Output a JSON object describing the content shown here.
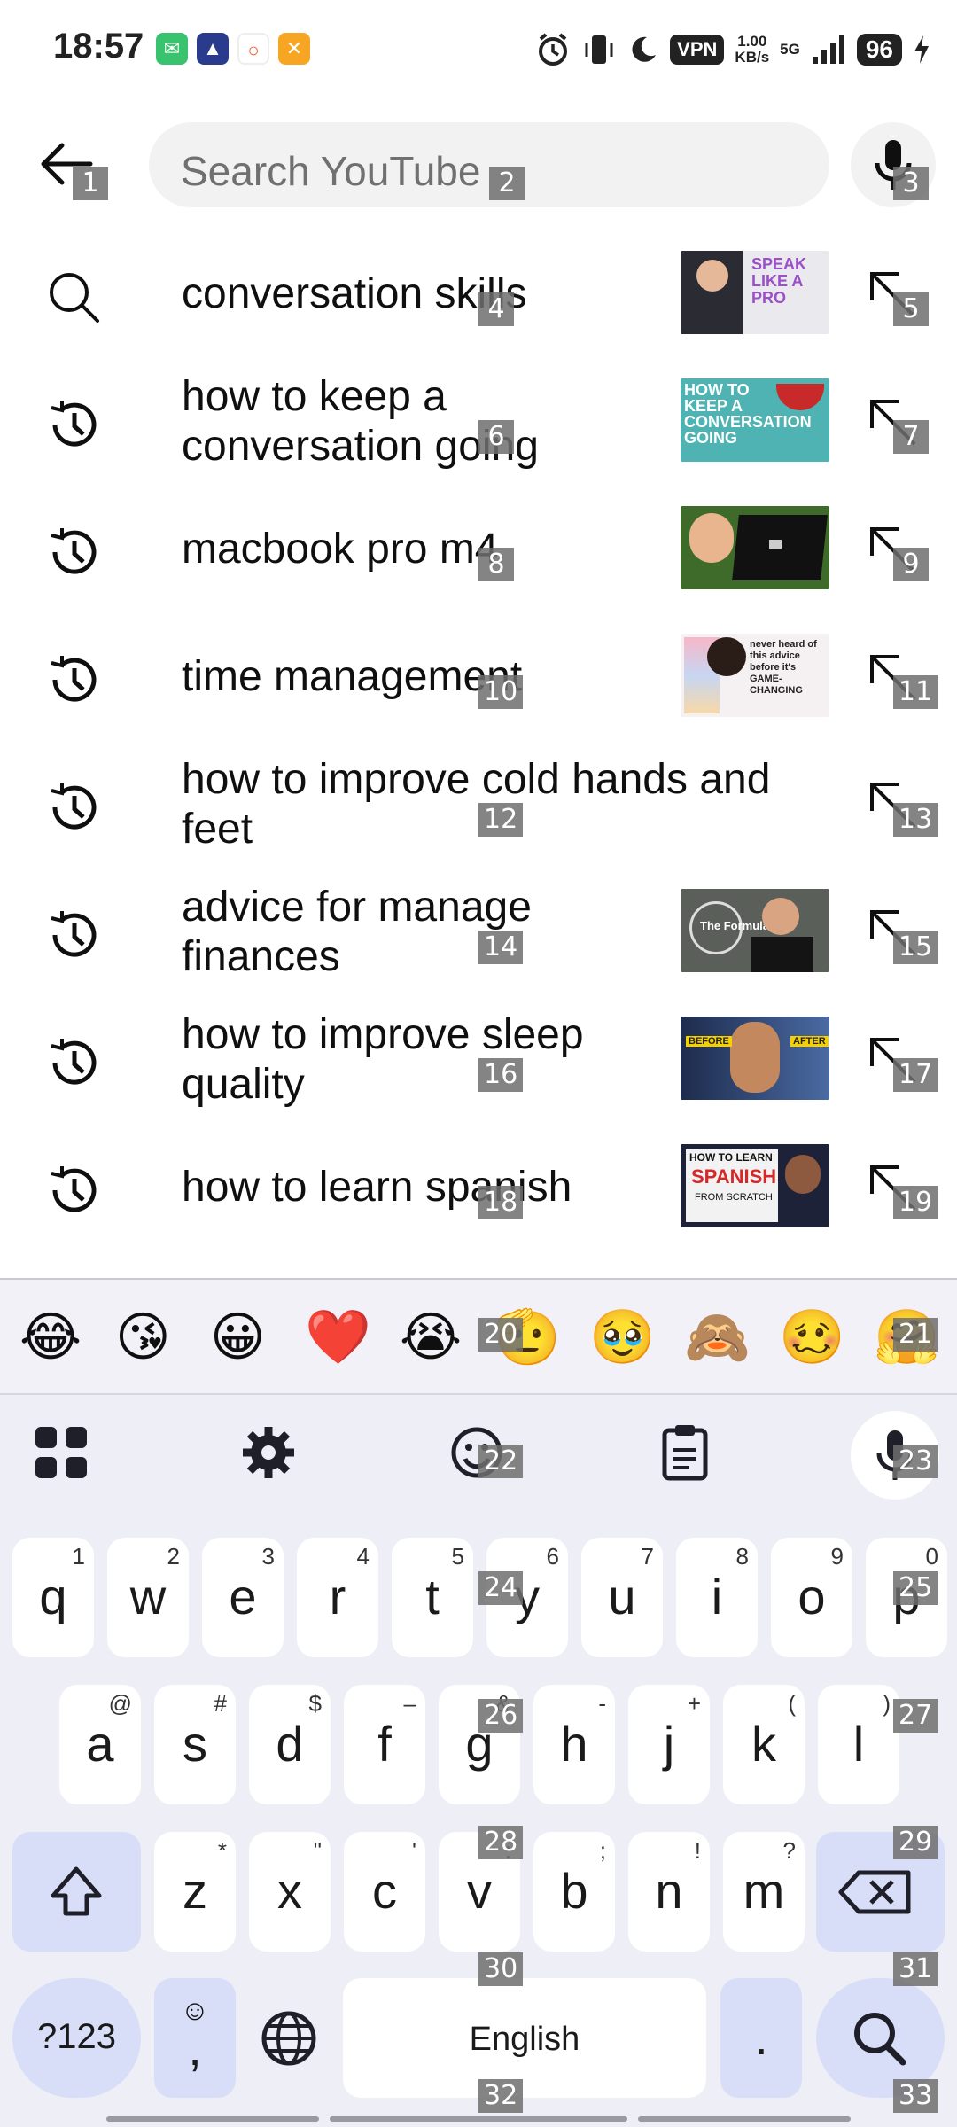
{
  "status_bar": {
    "time": "18:57",
    "vpn": "VPN",
    "speed_value": "1.00",
    "speed_unit": "KB/s",
    "network": "5G",
    "battery": "96"
  },
  "header": {
    "search_placeholder": "Search YouTube"
  },
  "suggestions": [
    {
      "text": "conversation skills",
      "icon": "search-icon"
    },
    {
      "text": "how to keep a conversation going",
      "icon": "history-icon"
    },
    {
      "text": "macbook pro m4",
      "icon": "history-icon"
    },
    {
      "text": "time management",
      "icon": "history-icon"
    },
    {
      "text": "how to improve cold hands and feet",
      "icon": "history-icon"
    },
    {
      "text": "advice for manage finances",
      "icon": "history-icon"
    },
    {
      "text": "how to improve sleep quality",
      "icon": "history-icon"
    },
    {
      "text": "how to learn spanish",
      "icon": "history-icon"
    }
  ],
  "thumbnails": {
    "t1_text": "SPEAK LIKE A PRO",
    "t2_text": "HOW TO KEEP A CONVERSATION GOING",
    "t4_text": "never heard of this advice before it's GAME-CHANGING",
    "t5_text": "The Formula",
    "t6_before": "BEFORE",
    "t6_after": "AFTER",
    "t7_line1": "HOW TO LEARN",
    "t7_line2": "SPANISH",
    "t7_line3": "FROM SCRATCH"
  },
  "keyboard": {
    "emojis": [
      "😂",
      "😘",
      "😀",
      "❤️",
      "😭",
      "🫡",
      "🥹",
      "🙈",
      "🥴",
      "🤗"
    ],
    "row1": [
      {
        "ch": "q",
        "sub": "1"
      },
      {
        "ch": "w",
        "sub": "2"
      },
      {
        "ch": "e",
        "sub": "3"
      },
      {
        "ch": "r",
        "sub": "4"
      },
      {
        "ch": "t",
        "sub": "5"
      },
      {
        "ch": "y",
        "sub": "6"
      },
      {
        "ch": "u",
        "sub": "7"
      },
      {
        "ch": "i",
        "sub": "8"
      },
      {
        "ch": "o",
        "sub": "9"
      },
      {
        "ch": "p",
        "sub": "0"
      }
    ],
    "row2": [
      {
        "ch": "a",
        "sub": "@"
      },
      {
        "ch": "s",
        "sub": "#"
      },
      {
        "ch": "d",
        "sub": "$"
      },
      {
        "ch": "f",
        "sub": "–"
      },
      {
        "ch": "g",
        "sub": "&"
      },
      {
        "ch": "h",
        "sub": "-"
      },
      {
        "ch": "j",
        "sub": "+"
      },
      {
        "ch": "k",
        "sub": "("
      },
      {
        "ch": "l",
        "sub": ")"
      }
    ],
    "row3": [
      {
        "ch": "z",
        "sub": "*"
      },
      {
        "ch": "x",
        "sub": "\""
      },
      {
        "ch": "c",
        "sub": "'"
      },
      {
        "ch": "v",
        "sub": ":"
      },
      {
        "ch": "b",
        "sub": ";"
      },
      {
        "ch": "n",
        "sub": "!"
      },
      {
        "ch": "m",
        "sub": "?"
      }
    ],
    "symbols_label": "?123",
    "comma_label": ",",
    "space_label": "English",
    "period_label": "."
  },
  "tags": [
    "1",
    "2",
    "3",
    "4",
    "5",
    "6",
    "7",
    "8",
    "9",
    "10",
    "11",
    "12",
    "13",
    "14",
    "15",
    "16",
    "17",
    "18",
    "19",
    "20",
    "21",
    "22",
    "23",
    "24",
    "25",
    "26",
    "27",
    "28",
    "29",
    "30",
    "31",
    "32",
    "33"
  ]
}
